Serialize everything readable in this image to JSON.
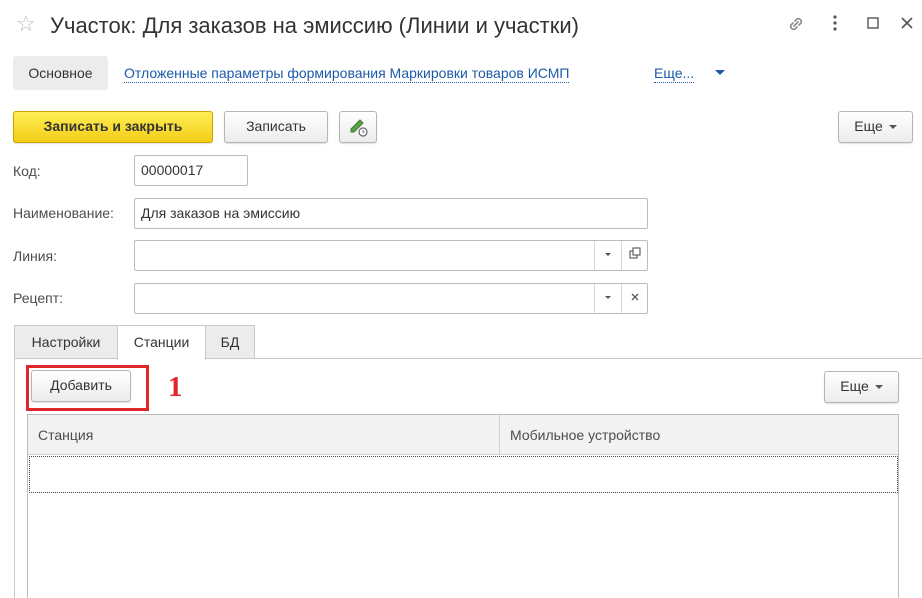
{
  "window": {
    "title": "Участок: Для заказов на эмиссию (Линии и участки)",
    "icons": [
      "star-icon",
      "link-icon",
      "kebab-menu-icon",
      "maximize-icon",
      "close-icon"
    ]
  },
  "nav": {
    "main_label": "Основное",
    "link_label": "Отложенные параметры формирования Маркировки товаров ИСМП",
    "more_label": "Еще..."
  },
  "toolbar": {
    "save_close_label": "Записать и закрыть",
    "save_label": "Записать",
    "more_label": "Еще"
  },
  "form": {
    "code_label": "Код:",
    "code_value": "00000017",
    "name_label": "Наименование:",
    "name_value": "Для заказов на эмиссию",
    "line_label": "Линия:",
    "line_value": "",
    "recipe_label": "Рецепт:",
    "recipe_value": ""
  },
  "tabs": [
    {
      "label": "Настройки",
      "active": false
    },
    {
      "label": "Станции",
      "active": true
    },
    {
      "label": "БД",
      "active": false
    }
  ],
  "stations": {
    "add_label": "Добавить",
    "more_label": "Еще",
    "columns": [
      "Станция",
      "Мобильное устройство"
    ],
    "rows": []
  },
  "annotation": {
    "marker_number": "1",
    "color": "#e0262a"
  },
  "colors": {
    "primary_button": "#f3cd17",
    "link": "#1d5aa8"
  }
}
